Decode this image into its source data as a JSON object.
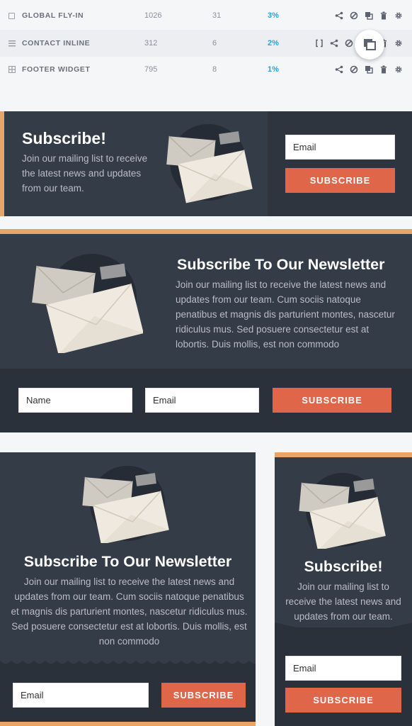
{
  "table": {
    "rows": [
      {
        "name": "GLOBAL FLY-IN",
        "views": "1026",
        "conversions": "31",
        "rate": "3%"
      },
      {
        "name": "CONTACT INLINE",
        "views": "312",
        "conversions": "6",
        "rate": "2%"
      },
      {
        "name": "FOOTER WIDGET",
        "views": "795",
        "conversions": "8",
        "rate": "1%"
      }
    ]
  },
  "widget_inline": {
    "title": "Subscribe!",
    "description": "Join our mailing list to receive the latest news and updates from our team.",
    "email_placeholder": "Email",
    "button_label": "SUBSCRIBE"
  },
  "widget_wide": {
    "title": "Subscribe To Our Newsletter",
    "description": "Join our mailing list to receive the latest news and updates from our team. Cum sociis natoque penatibus et magnis dis parturient montes, nascetur ridiculus mus. Sed posuere consectetur est at lobortis. Duis mollis, est non commodo",
    "name_placeholder": "Name",
    "email_placeholder": "Email",
    "button_label": "SUBSCRIBE"
  },
  "widget_centered": {
    "title": "Subscribe To Our Newsletter",
    "description": "Join our mailing list to receive the latest news and updates from our team. Cum sociis natoque penatibus et magnis dis parturient montes, nascetur ridiculus mus. Sed posuere consectetur est at lobortis. Duis mollis, est non commodo",
    "email_placeholder": "Email",
    "button_label": "SUBSCRIBE"
  },
  "widget_sidebar": {
    "title": "Subscribe!",
    "description": "Join our mailing list to receive the latest news and updates from our team.",
    "email_placeholder": "Email",
    "button_label": "SUBSCRIBE"
  },
  "colors": {
    "panel": "#343c48",
    "accent_orange": "#e8a56a",
    "button": "#e0664a",
    "rate_blue": "#1fa6de"
  }
}
